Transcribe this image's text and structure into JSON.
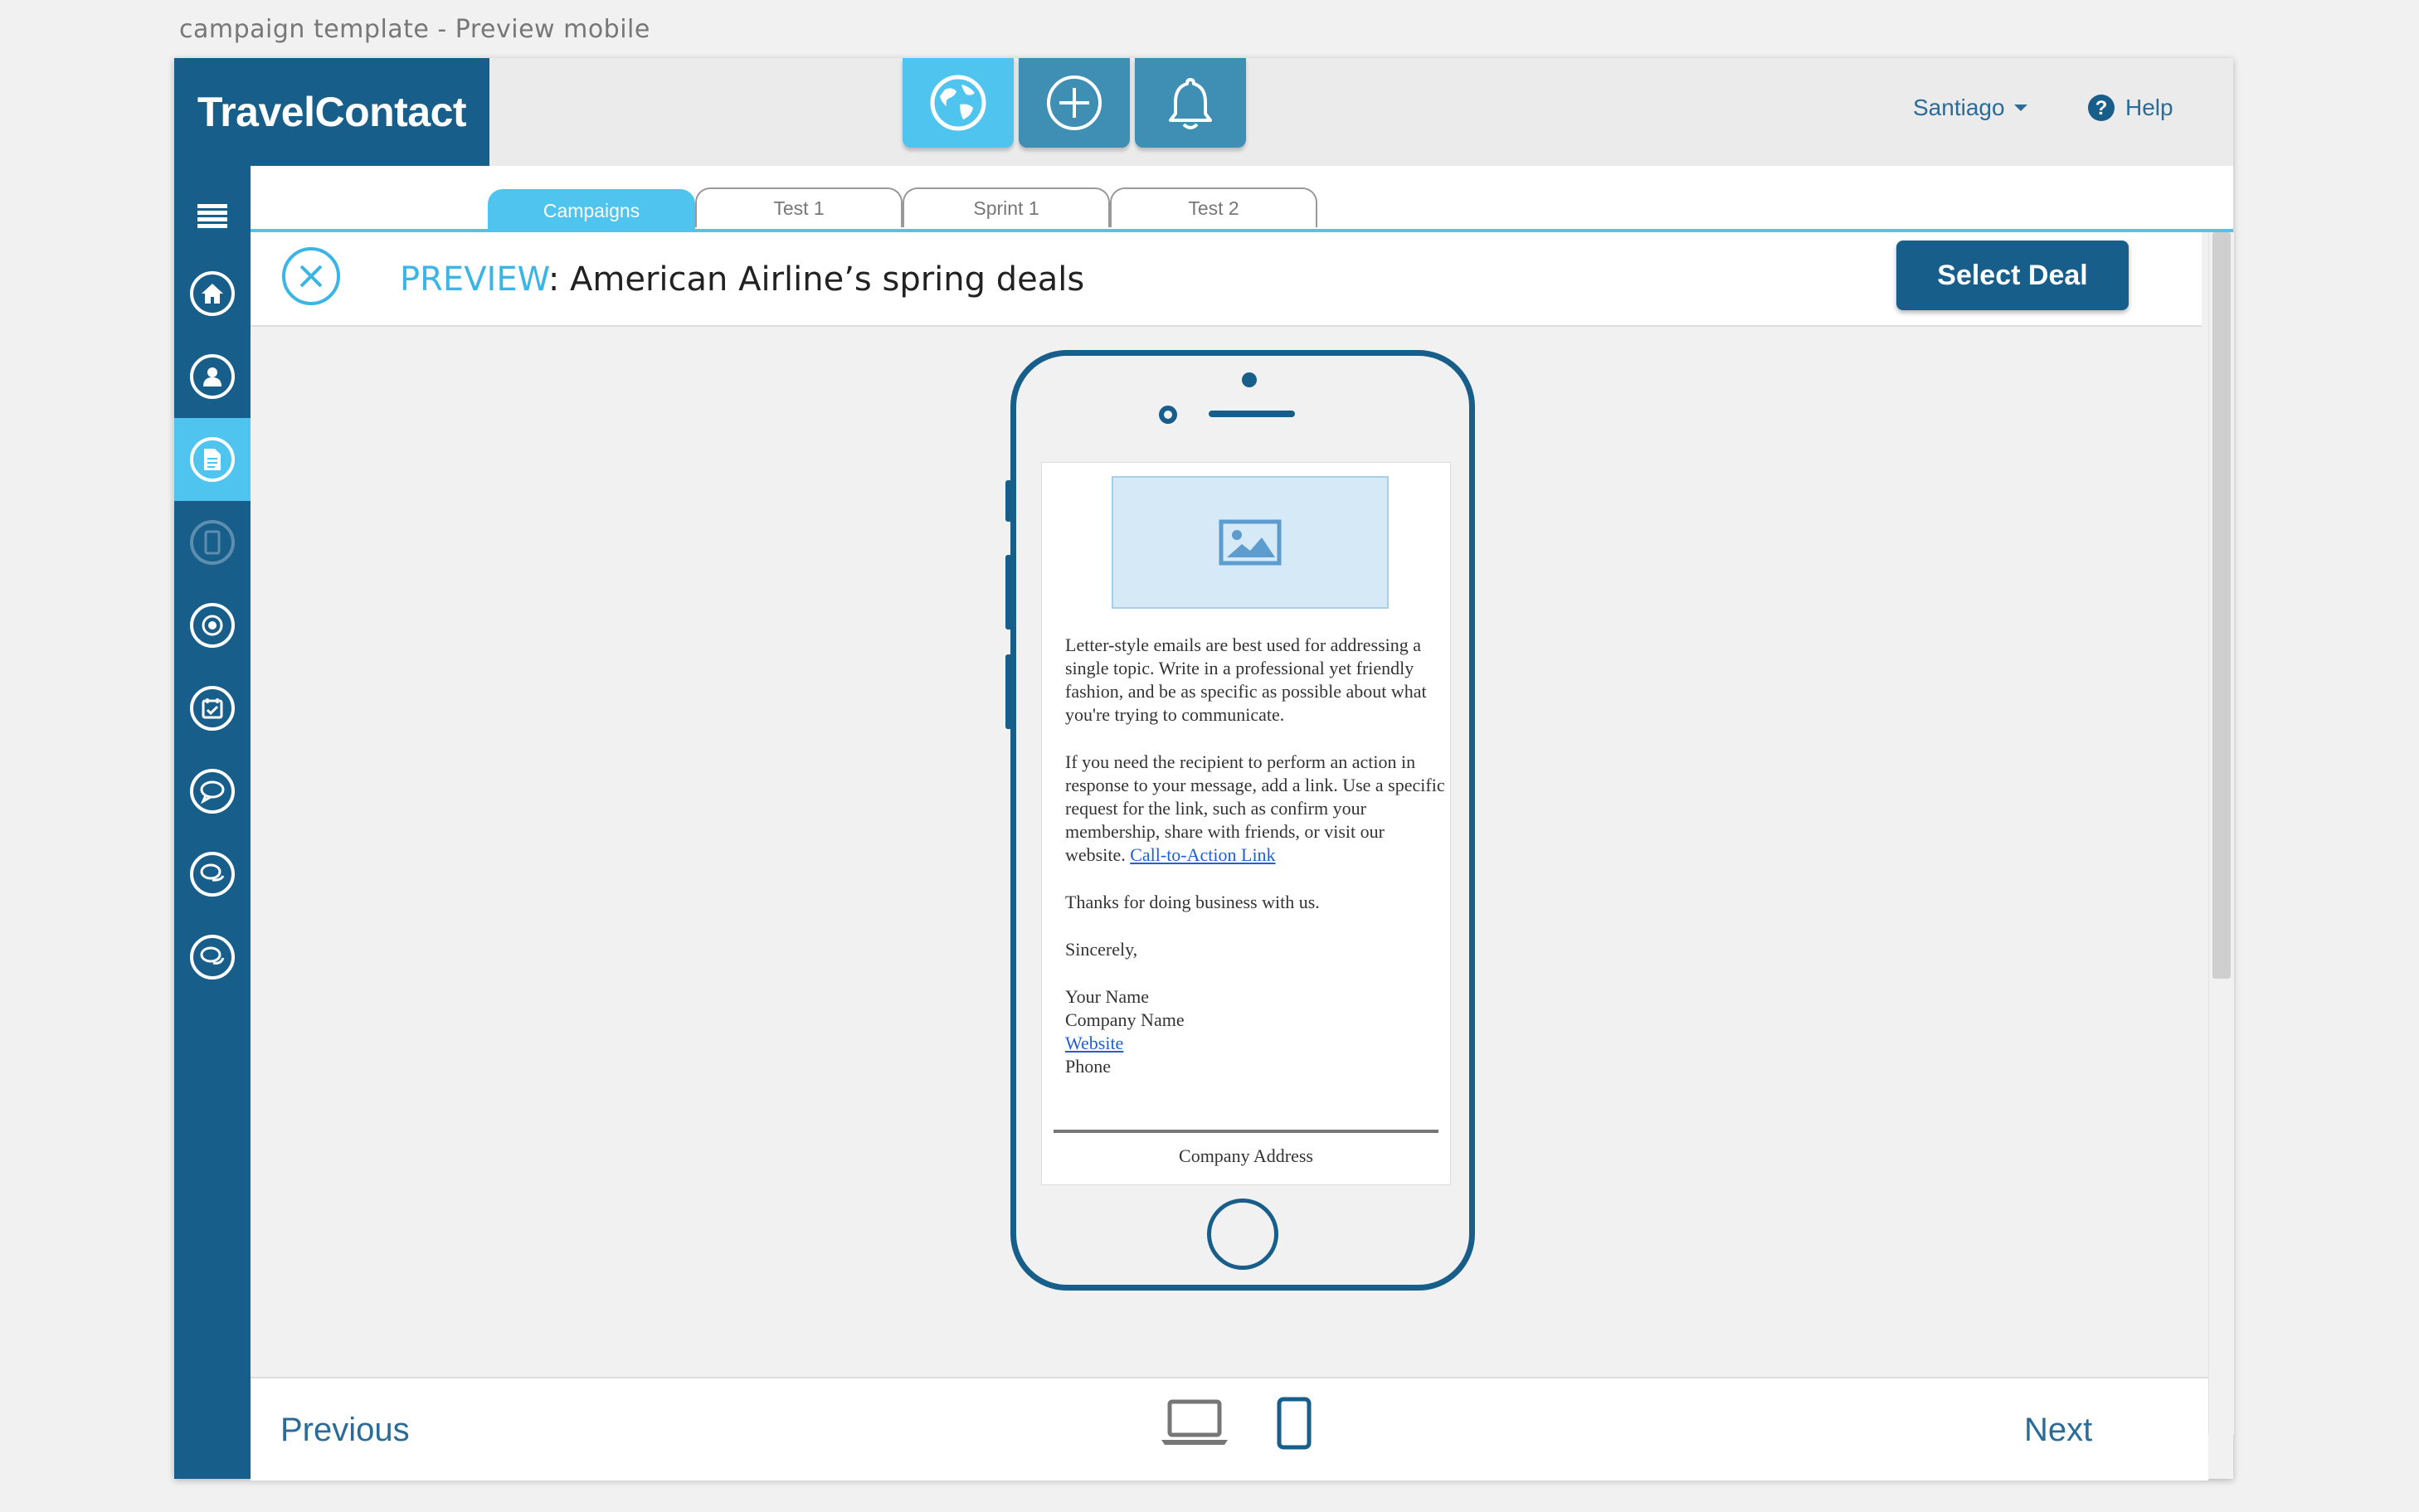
{
  "window": {
    "title": "campaign template - Preview mobile"
  },
  "brand": {
    "name": "TravelContact"
  },
  "topbar": {
    "icons": [
      {
        "icon": "globe-icon",
        "active": true
      },
      {
        "icon": "plus-circle-icon",
        "active": false
      },
      {
        "icon": "bell-icon",
        "active": false
      }
    ],
    "user": "Santiago",
    "help": "Help"
  },
  "sidebar": {
    "items": [
      "menu-icon",
      "home-icon",
      "user-icon",
      "document-icon",
      "tablet-icon",
      "target-icon",
      "calendar-check-icon",
      "chat-icon",
      "chat-double-icon",
      "chat-multi-icon"
    ],
    "active_index": 3
  },
  "tabs": [
    {
      "label": "Campaigns",
      "active": true
    },
    {
      "label": "Test 1",
      "active": false
    },
    {
      "label": "Sprint 1",
      "active": false
    },
    {
      "label": "Test 2",
      "active": false
    }
  ],
  "preview": {
    "keyword": "PREVIEW",
    "separator": ": ",
    "title": "American Airline’s spring deals",
    "select_button": "Select Deal"
  },
  "email": {
    "para1": "Letter-style emails are best used for addressing a single topic. Write in a professional yet friendly fashion, and be as specific as possible about what you're trying to communicate.",
    "para2": "If you need the recipient to perform an action in response to your message, add a link. Use a specific request for the link, such as confirm your membership, share with friends, or visit our website.",
    "cta_link": "Call-to-Action Link",
    "para3": "Thanks for doing business with us.",
    "sign_off": "Sincerely,",
    "your_name": "Your Name",
    "company_name": "Company Name",
    "website_link": "Website",
    "phone": "Phone",
    "company_address": "Company Address"
  },
  "footer": {
    "previous": "Previous",
    "next": "Next",
    "devices": [
      {
        "icon": "laptop-icon",
        "active": false
      },
      {
        "icon": "mobile-icon",
        "active": true
      }
    ]
  },
  "colors": {
    "brand_dark": "#175e8a",
    "accent": "#4ec4ef",
    "link": "#2a6b97"
  }
}
